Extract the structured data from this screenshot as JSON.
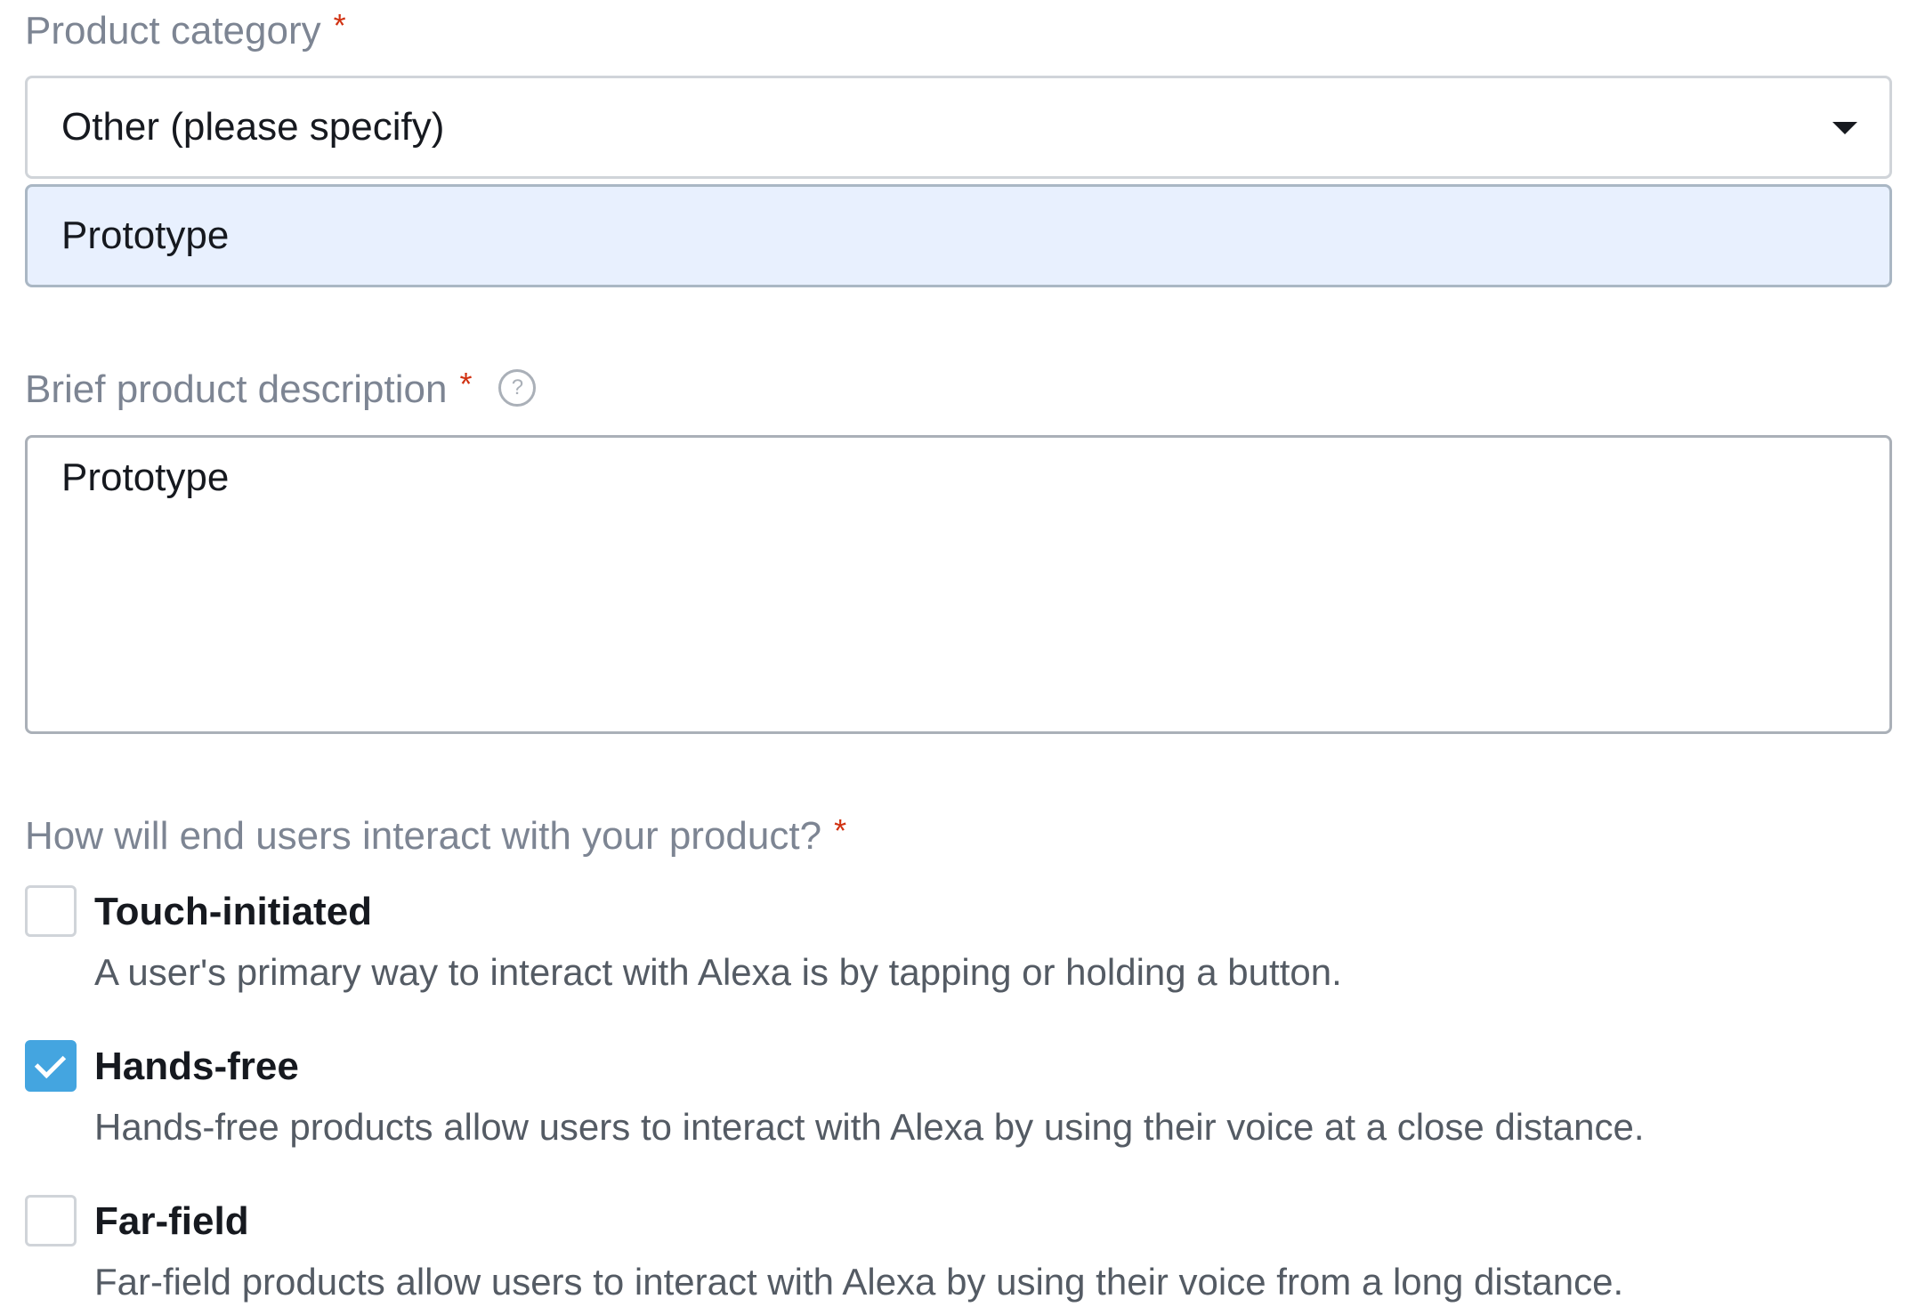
{
  "category": {
    "label": "Product category",
    "required_mark": "*",
    "selected_value": "Other (please specify)",
    "specify_value": "Prototype"
  },
  "description": {
    "label": "Brief product description",
    "required_mark": "*",
    "help_glyph": "?",
    "value": "Prototype"
  },
  "interaction": {
    "label": "How will end users interact with your product?",
    "required_mark": "*",
    "options": [
      {
        "title": "Touch-initiated",
        "description": "A user's primary way to interact with Alexa is by tapping or holding a button.",
        "checked": false
      },
      {
        "title": "Hands-free",
        "description": "Hands-free products allow users to interact with Alexa by using their voice at a close distance.",
        "checked": true
      },
      {
        "title": "Far-field",
        "description": "Far-field products allow users to interact with Alexa by using their voice from a long distance.",
        "checked": false
      }
    ]
  },
  "colors": {
    "accent": "#44a5e0",
    "required": "#d13212",
    "autofill_bg": "#e8f0fe",
    "label_gray": "#7d8593"
  },
  "icons": {
    "dropdown": "caret-down-icon",
    "help": "help-circle-icon",
    "checkmark": "checkmark-icon"
  }
}
